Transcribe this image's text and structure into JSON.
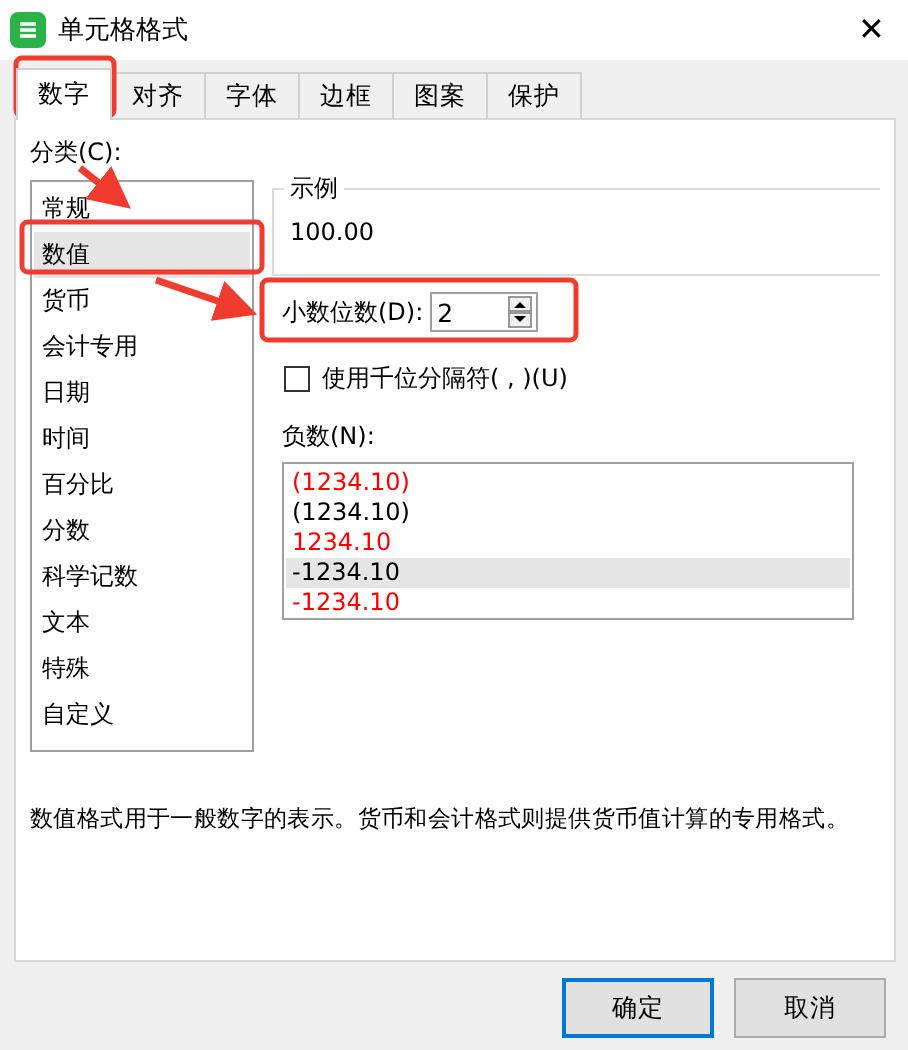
{
  "window": {
    "title": "单元格格式",
    "close": "✕"
  },
  "tabs": [
    {
      "label": "数字",
      "selected": true
    },
    {
      "label": "对齐",
      "selected": false
    },
    {
      "label": "字体",
      "selected": false
    },
    {
      "label": "边框",
      "selected": false
    },
    {
      "label": "图案",
      "selected": false
    },
    {
      "label": "保护",
      "selected": false
    }
  ],
  "category": {
    "label": "分类(C):",
    "items": [
      {
        "label": "常规",
        "selected": false
      },
      {
        "label": "数值",
        "selected": true
      },
      {
        "label": "货币",
        "selected": false
      },
      {
        "label": "会计专用",
        "selected": false
      },
      {
        "label": "日期",
        "selected": false
      },
      {
        "label": "时间",
        "selected": false
      },
      {
        "label": "百分比",
        "selected": false
      },
      {
        "label": "分数",
        "selected": false
      },
      {
        "label": "科学记数",
        "selected": false
      },
      {
        "label": "文本",
        "selected": false
      },
      {
        "label": "特殊",
        "selected": false
      },
      {
        "label": "自定义",
        "selected": false
      }
    ]
  },
  "sample": {
    "label": "示例",
    "value": "100.00"
  },
  "decimal_places": {
    "label": "小数位数(D):",
    "value": "2"
  },
  "thousands_separator": {
    "label": "使用千位分隔符( , )(U)",
    "checked": false
  },
  "negative_numbers": {
    "label": "负数(N):",
    "items": [
      {
        "label": "(1234.10)",
        "color": "#ff0000",
        "selected": false
      },
      {
        "label": "(1234.10)",
        "color": "#000000",
        "selected": false
      },
      {
        "label": "1234.10",
        "color": "#ff0000",
        "selected": false
      },
      {
        "label": "-1234.10",
        "color": "#000000",
        "selected": true
      },
      {
        "label": "-1234.10",
        "color": "#ff0000",
        "selected": false
      }
    ]
  },
  "description": "数值格式用于一般数字的表示。货币和会计格式则提供货币值计算的专用格式。",
  "buttons": [
    {
      "label": "确定",
      "default": true
    },
    {
      "label": "取消",
      "default": false
    }
  ]
}
